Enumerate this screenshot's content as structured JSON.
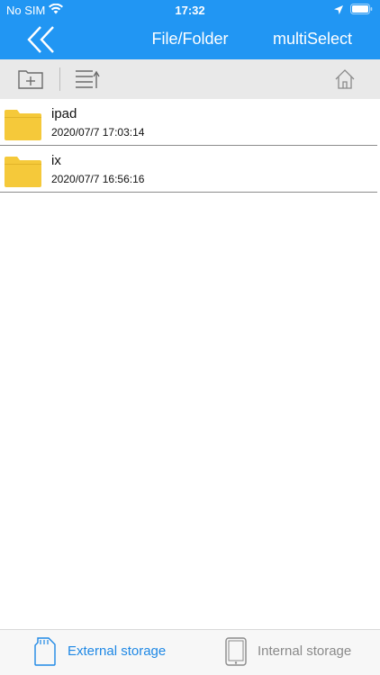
{
  "status_bar": {
    "carrier": "No SIM",
    "time": "17:32"
  },
  "nav": {
    "title": "File/Folder",
    "action_label": "multiSelect"
  },
  "toolbar": {
    "new_folder_icon": "add-folder-icon",
    "sort_icon": "sort-list-icon",
    "home_icon": "home-icon"
  },
  "files": [
    {
      "name": "ipad",
      "date": "2020/07/7 17:03:14",
      "icon": "folder-icon"
    },
    {
      "name": "ix",
      "date": "2020/07/7 16:56:16",
      "icon": "folder-icon"
    }
  ],
  "tabs": [
    {
      "label": "External storage",
      "icon": "sd-card-icon",
      "active": true
    },
    {
      "label": "Internal storage",
      "icon": "tablet-icon",
      "active": false
    }
  ],
  "colors": {
    "accent": "#2196f3",
    "folder": "#f5c93a",
    "active_tab": "#1e88e5",
    "inactive_tab": "#8a8a8a"
  }
}
